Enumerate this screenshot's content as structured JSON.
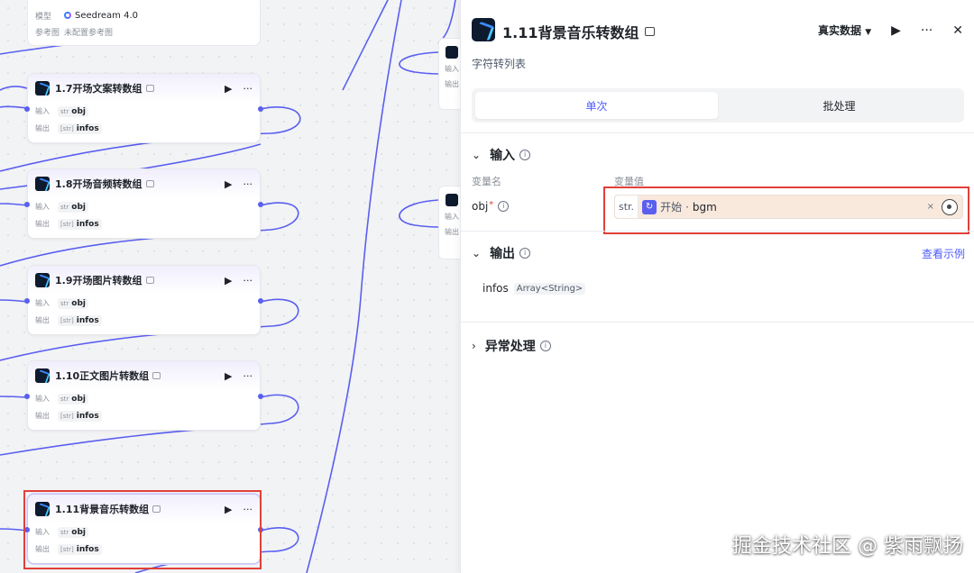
{
  "top_node": {
    "model_label": "模型",
    "model_value": "Seedream 4.0",
    "ref_label": "参考图",
    "ref_value": "未配置参考图"
  },
  "nodes": [
    {
      "title": "1.7开场文案转数组",
      "input_label": "输入",
      "input_type": "str",
      "input_name": "obj",
      "output_label": "输出",
      "output_type": "[str]",
      "output_name": "infos"
    },
    {
      "title": "1.8开场音频转数组",
      "input_label": "输入",
      "input_type": "str",
      "input_name": "obj",
      "output_label": "输出",
      "output_type": "[str]",
      "output_name": "infos"
    },
    {
      "title": "1.9开场图片转数组",
      "input_label": "输入",
      "input_type": "str",
      "input_name": "obj",
      "output_label": "输出",
      "output_type": "[str]",
      "output_name": "infos"
    },
    {
      "title": "1.10正文图片转数组",
      "input_label": "输入",
      "input_type": "str",
      "input_name": "obj",
      "output_label": "输出",
      "output_type": "[str]",
      "output_name": "infos"
    },
    {
      "title": "1.11背景音乐转数组",
      "input_label": "输入",
      "input_type": "str",
      "input_name": "obj",
      "output_label": "输出",
      "output_type": "[str]",
      "output_name": "infos"
    }
  ],
  "mid_nodes": [
    {
      "in": "输入",
      "out": "输出"
    },
    {
      "in": "输入",
      "out": "输出"
    }
  ],
  "node_actions": {
    "run": "▶",
    "more": "···"
  },
  "panel": {
    "title": "1.11背景音乐转数组",
    "description": "字符转列表",
    "data_mode": "真实数据",
    "data_mode_caret": "▼",
    "run_icon": "▶",
    "more_icon": "···",
    "close_icon": "✕",
    "tabs": [
      {
        "label": "单次",
        "active": true
      },
      {
        "label": "批处理",
        "active": false
      }
    ],
    "input_section": {
      "chevron": "⌄",
      "title": "输入",
      "col_name": "变量名",
      "col_value": "变量值",
      "field_name": "obj",
      "required_mark": "*",
      "value_type": "str.",
      "value_source": "开始",
      "value_separator": "·",
      "value_var": "bgm",
      "clear_icon": "×"
    },
    "output_section": {
      "chevron": "⌄",
      "title": "输出",
      "example_link": "查看示例",
      "field_name": "infos",
      "field_type": "Array<String>"
    },
    "error_section": {
      "chevron": "›",
      "title": "异常处理"
    },
    "info_glyph": "i"
  },
  "watermark": "掘金技术社区 @ 紫雨飘扬",
  "colors": {
    "accent": "#4e5bff",
    "highlight_border": "#e0403a",
    "wire": "#5a5ff0"
  }
}
